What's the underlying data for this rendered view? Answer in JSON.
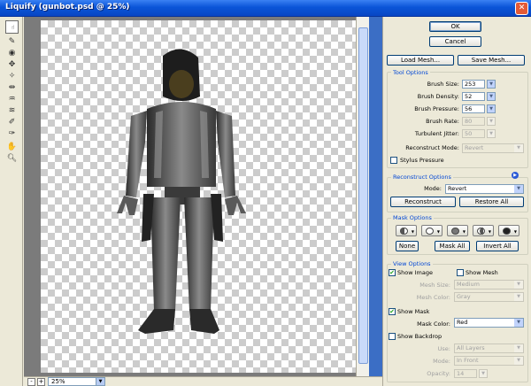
{
  "window": {
    "title": "Liquify (gunbot.psd @ 25%)"
  },
  "tools": [
    {
      "icon": "forward-warp-icon"
    },
    {
      "icon": "reconstruct-tool-icon"
    },
    {
      "icon": "twirl-clockwise-icon"
    },
    {
      "icon": "pucker-icon"
    },
    {
      "icon": "bloat-icon"
    },
    {
      "icon": "push-left-icon"
    },
    {
      "icon": "mirror-icon"
    },
    {
      "icon": "turbulence-icon"
    },
    {
      "icon": "freeze-mask-icon"
    },
    {
      "icon": "thaw-mask-icon"
    },
    {
      "icon": "hand-icon"
    },
    {
      "icon": "zoom-icon"
    }
  ],
  "status": {
    "zoom": "25%",
    "zoom_out": "-",
    "zoom_in": "+"
  },
  "buttons": {
    "ok": "OK",
    "cancel": "Cancel",
    "load_mesh": "Load Mesh...",
    "save_mesh": "Save Mesh..."
  },
  "tool_options": {
    "title": "Tool Options",
    "brush_size": {
      "label": "Brush Size:",
      "value": "253"
    },
    "brush_density": {
      "label": "Brush Density:",
      "value": "52"
    },
    "brush_pressure": {
      "label": "Brush Pressure:",
      "value": "56"
    },
    "brush_rate": {
      "label": "Brush Rate:",
      "value": "80"
    },
    "turbulent_jitter": {
      "label": "Turbulent Jitter:",
      "value": "50"
    },
    "reconstruct_mode": {
      "label": "Reconstruct Mode:",
      "value": "Revert"
    },
    "stylus_pressure": {
      "label": "Stylus Pressure",
      "checked": false
    }
  },
  "reconstruct_options": {
    "title": "Reconstruct Options",
    "mode_label": "Mode:",
    "mode_value": "Revert",
    "reconstruct_btn": "Reconstruct",
    "restore_all_btn": "Restore All"
  },
  "mask_options": {
    "title": "Mask Options",
    "none_btn": "None",
    "mask_all_btn": "Mask All",
    "invert_all_btn": "Invert All"
  },
  "view_options": {
    "title": "View Options",
    "show_image": {
      "label": "Show Image",
      "checked": true
    },
    "show_mesh": {
      "label": "Show Mesh",
      "checked": false
    },
    "mesh_size": {
      "label": "Mesh Size:",
      "value": "Medium"
    },
    "mesh_color": {
      "label": "Mesh Color:",
      "value": "Gray"
    },
    "show_mask": {
      "label": "Show Mask",
      "checked": true
    },
    "mask_color": {
      "label": "Mask Color:",
      "value": "Red"
    },
    "show_backdrop": {
      "label": "Show Backdrop",
      "checked": false
    },
    "use": {
      "label": "Use:",
      "value": "All Layers"
    },
    "mode": {
      "label": "Mode:",
      "value": "In Front"
    },
    "opacity": {
      "label": "Opacity:",
      "value": "14"
    }
  },
  "colors": {
    "title_bar": "#0a55d8",
    "panel_bg": "#ece9d8",
    "legend": "#0046d5"
  }
}
